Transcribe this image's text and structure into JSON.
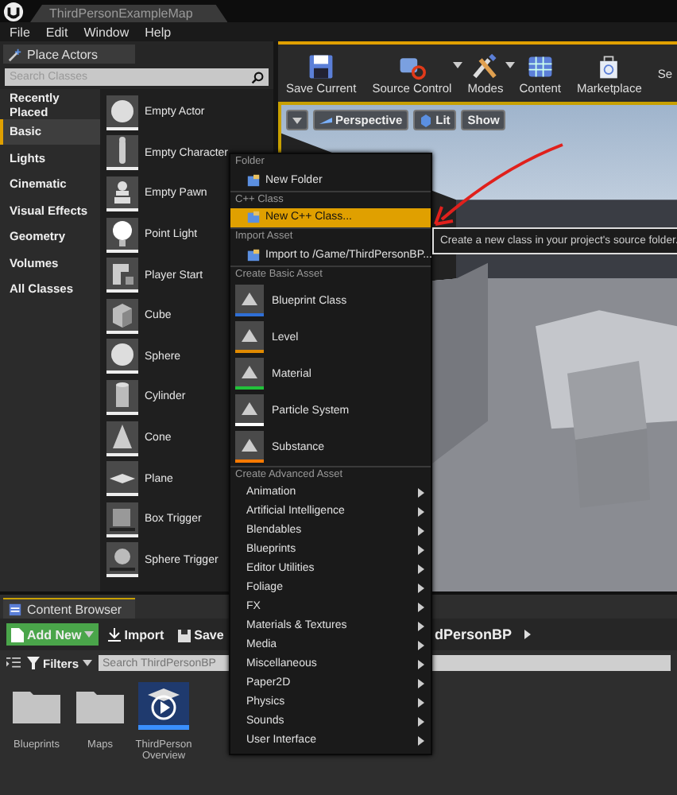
{
  "window": {
    "title": "ThirdPersonExampleMap"
  },
  "menu_bar": [
    "File",
    "Edit",
    "Window",
    "Help"
  ],
  "place_actors": {
    "tab": "Place Actors",
    "search": {
      "placeholder": "Search Classes"
    },
    "categories": [
      {
        "label": "Recently Placed",
        "selected": false
      },
      {
        "label": "Basic",
        "selected": true
      },
      {
        "label": "Lights",
        "selected": false
      },
      {
        "label": "Cinematic",
        "selected": false
      },
      {
        "label": "Visual Effects",
        "selected": false
      },
      {
        "label": "Geometry",
        "selected": false
      },
      {
        "label": "Volumes",
        "selected": false
      },
      {
        "label": "All Classes",
        "selected": false
      }
    ],
    "actors": [
      {
        "label": "Empty Actor",
        "kind": "sphere"
      },
      {
        "label": "Empty Character",
        "kind": "character"
      },
      {
        "label": "Empty Pawn",
        "kind": "pawn"
      },
      {
        "label": "Point Light",
        "kind": "light"
      },
      {
        "label": "Player Start",
        "kind": "start"
      },
      {
        "label": "Cube",
        "kind": "cube"
      },
      {
        "label": "Sphere",
        "kind": "sphere"
      },
      {
        "label": "Cylinder",
        "kind": "cylinder"
      },
      {
        "label": "Cone",
        "kind": "cone"
      },
      {
        "label": "Plane",
        "kind": "plane"
      },
      {
        "label": "Box Trigger",
        "kind": "box-trigger"
      },
      {
        "label": "Sphere Trigger",
        "kind": "sphere-trigger"
      }
    ]
  },
  "toolbar": [
    {
      "label": "Save Current",
      "kind": "save",
      "dropdown": false
    },
    {
      "label": "Source Control",
      "kind": "source",
      "dropdown": true
    },
    {
      "label": "Modes",
      "kind": "modes",
      "dropdown": true
    },
    {
      "label": "Content",
      "kind": "content",
      "dropdown": false
    },
    {
      "label": "Marketplace",
      "kind": "marketplace",
      "dropdown": false
    },
    {
      "label": "Se",
      "kind": "cut",
      "dropdown": false
    }
  ],
  "viewport": {
    "buttons": [
      {
        "label": "Perspective",
        "kind": "perspective"
      },
      {
        "label": "Lit",
        "kind": "lit"
      },
      {
        "label": "Show",
        "kind": "plain"
      }
    ]
  },
  "content_browser": {
    "tab": "Content Browser",
    "buttons": [
      {
        "label": "Add New",
        "kind": "add"
      },
      {
        "label": "Import",
        "kind": "import"
      },
      {
        "label": "Save",
        "kind": "save"
      }
    ],
    "path": "dPersonBP",
    "filters": "Filters",
    "search": {
      "placeholder": "Search ThirdPersonBP"
    },
    "assets": [
      {
        "label": "Blueprints",
        "kind": "folder"
      },
      {
        "label": "Maps",
        "kind": "folder"
      },
      {
        "label": "ThirdPerson Overview",
        "kind": "tutorial"
      }
    ]
  },
  "context_menu": {
    "sections": [
      {
        "heading": "Folder",
        "items": [
          {
            "label": "New Folder",
            "kind": "simple",
            "selected": false
          }
        ]
      },
      {
        "heading": "C++ Class",
        "items": [
          {
            "label": "New C++ Class...",
            "kind": "simple",
            "selected": true
          }
        ]
      },
      {
        "heading": "Import Asset",
        "items": [
          {
            "label": "Import to /Game/ThirdPersonBP...",
            "kind": "simple",
            "selected": false
          }
        ]
      },
      {
        "heading": "Create Basic Asset",
        "items": [
          {
            "label": "Blueprint Class",
            "kind": "asset",
            "color": "#2f6fd6",
            "selected": false
          },
          {
            "label": "Level",
            "kind": "asset",
            "color": "#e08a00",
            "selected": false
          },
          {
            "label": "Material",
            "kind": "asset",
            "color": "#22c23a",
            "selected": false
          },
          {
            "label": "Particle System",
            "kind": "asset",
            "color": "#ffffff",
            "selected": false
          },
          {
            "label": "Substance",
            "kind": "asset",
            "color": "#ff7a00",
            "selected": false
          }
        ]
      },
      {
        "heading": "Create Advanced Asset",
        "items": [
          {
            "label": "Animation",
            "kind": "submenu",
            "selected": false
          },
          {
            "label": "Artificial Intelligence",
            "kind": "submenu",
            "selected": false
          },
          {
            "label": "Blendables",
            "kind": "submenu",
            "selected": false
          },
          {
            "label": "Blueprints",
            "kind": "submenu",
            "selected": false
          },
          {
            "label": "Editor Utilities",
            "kind": "submenu",
            "selected": false
          },
          {
            "label": "Foliage",
            "kind": "submenu",
            "selected": false
          },
          {
            "label": "FX",
            "kind": "submenu",
            "selected": false
          },
          {
            "label": "Materials & Textures",
            "kind": "submenu",
            "selected": false
          },
          {
            "label": "Media",
            "kind": "submenu",
            "selected": false
          },
          {
            "label": "Miscellaneous",
            "kind": "submenu",
            "selected": false
          },
          {
            "label": "Paper2D",
            "kind": "submenu",
            "selected": false
          },
          {
            "label": "Physics",
            "kind": "submenu",
            "selected": false
          },
          {
            "label": "Sounds",
            "kind": "submenu",
            "selected": false
          },
          {
            "label": "User Interface",
            "kind": "submenu",
            "selected": false
          }
        ]
      }
    ]
  },
  "tooltip": "Create a new class in your project's source folder."
}
